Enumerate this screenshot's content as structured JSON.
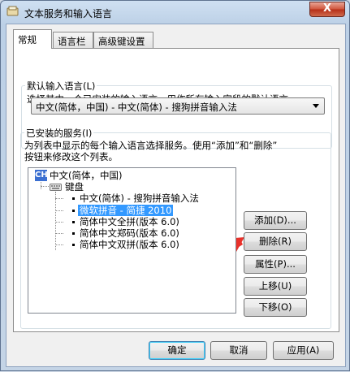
{
  "window": {
    "title": "文本服务和输入语言",
    "close_label": "X"
  },
  "tabs": [
    {
      "label": "常规",
      "active": true
    },
    {
      "label": "语言栏",
      "active": false
    },
    {
      "label": "高级键设置",
      "active": false
    }
  ],
  "default_lang": {
    "group_label": "默认输入语言(L)",
    "description": "选择其中一个已安装的输入语言，用作所有输入字段的默认语言。",
    "selected_value": "中文(简体，中国) - 中文(简体) - 搜狗拼音输入法"
  },
  "installed": {
    "group_label": "已安装的服务(I)",
    "description_line1": "为列表中显示的每个输入语言选择服务。使用“添加”和“删除”",
    "description_line2": "按钮来修改这个列表。",
    "tree": {
      "lang_badge": "CH",
      "lang_label": "中文(简体，中国)",
      "keyboard_label": "键盘",
      "items": [
        "中文(简体) - 搜狗拼音输入法",
        "微软拼音 - 简捷 2010",
        "简体中文全拼(版本 6.0)",
        "简体中文郑码(版本 6.0)",
        "简体中文双拼(版本 6.0)"
      ],
      "selected_index": 1
    },
    "buttons": {
      "add": "添加(D)...",
      "remove": "删除(R)",
      "properties": "属性(P)...",
      "move_up": "上移(U)",
      "move_down": "下移(O)"
    }
  },
  "footer": {
    "ok": "确定",
    "cancel": "取消",
    "apply": "应用(A)"
  },
  "colors": {
    "selection": "#3399ff",
    "annotation_arrow": "#e8312a",
    "lang_badge": "#3b6fd1"
  }
}
